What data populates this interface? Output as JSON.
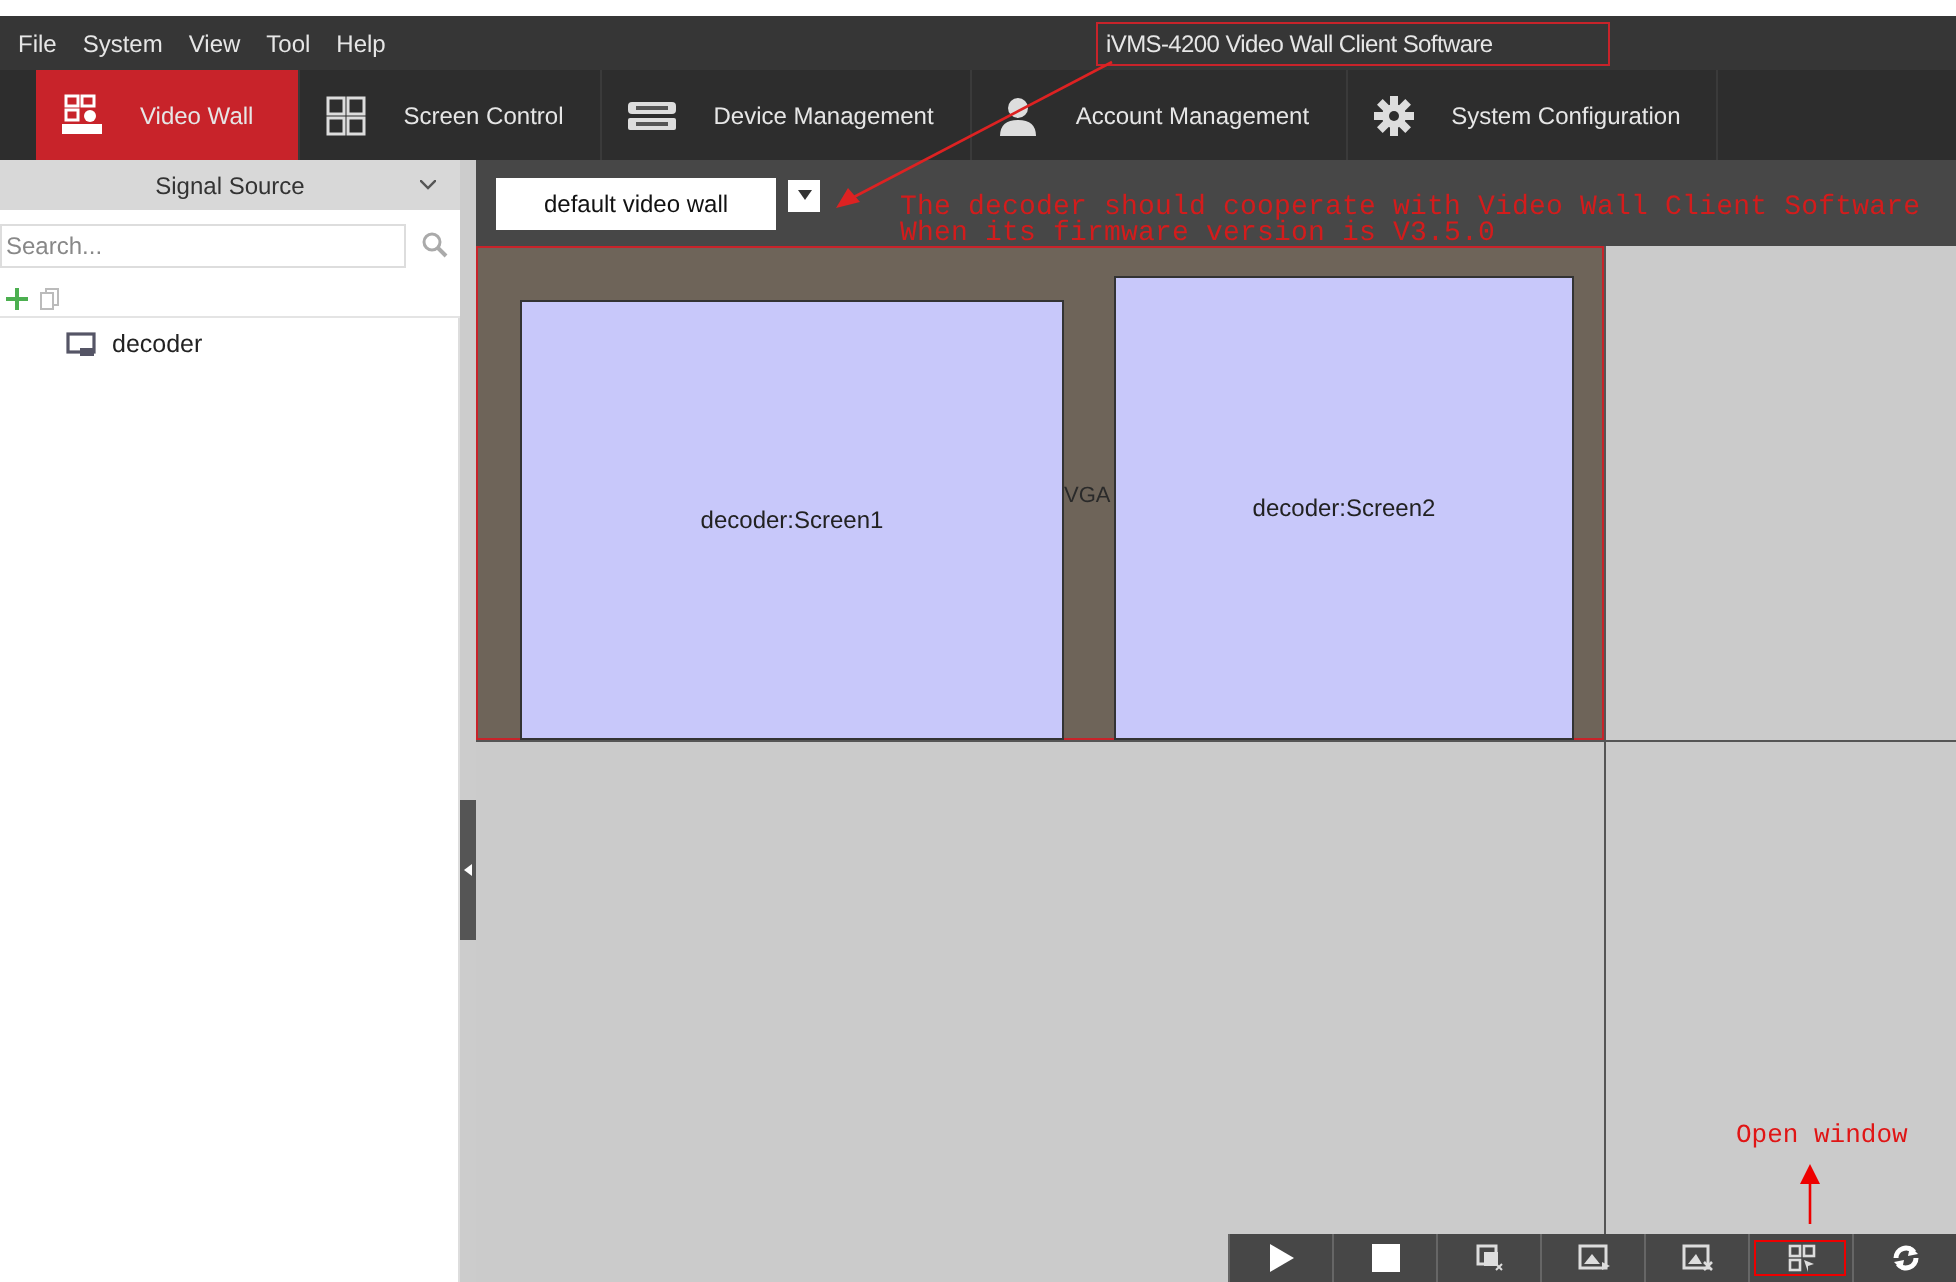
{
  "menu": [
    "File",
    "System",
    "View",
    "Tool",
    "Help"
  ],
  "window_title": "iVMS-4200 Video Wall Client Software",
  "tabs": [
    {
      "label": "Video Wall",
      "kind": "wall",
      "selected": true
    },
    {
      "label": "Screen Control",
      "kind": "grid",
      "selected": false
    },
    {
      "label": "Device Management",
      "kind": "device",
      "selected": false
    },
    {
      "label": "Account Management",
      "kind": "user",
      "selected": false
    },
    {
      "label": "System Configuration",
      "kind": "gear",
      "selected": false
    }
  ],
  "signal_source": {
    "title": "Signal Source",
    "search": {
      "placeholder": "Search..."
    },
    "tree": [
      {
        "label": "decoder"
      }
    ]
  },
  "wall": {
    "name": "default video wall",
    "port_label": "VGA",
    "windows": [
      {
        "label": "decoder:Screen1"
      },
      {
        "label": "decoder:Screen2"
      }
    ]
  },
  "annotations": {
    "decoder_note": [
      "The decoder should cooperate with Video Wall Client Software",
      "When its firmware version is V3.5.0"
    ],
    "open_window": "Open window"
  },
  "toolbar": [
    {
      "kind": "play",
      "highlighted": false
    },
    {
      "kind": "stop",
      "highlighted": false
    },
    {
      "kind": "close-window",
      "highlighted": false
    },
    {
      "kind": "image",
      "highlighted": false
    },
    {
      "kind": "image-close",
      "highlighted": false
    },
    {
      "kind": "open-window",
      "highlighted": true
    },
    {
      "kind": "refresh",
      "highlighted": false
    }
  ]
}
